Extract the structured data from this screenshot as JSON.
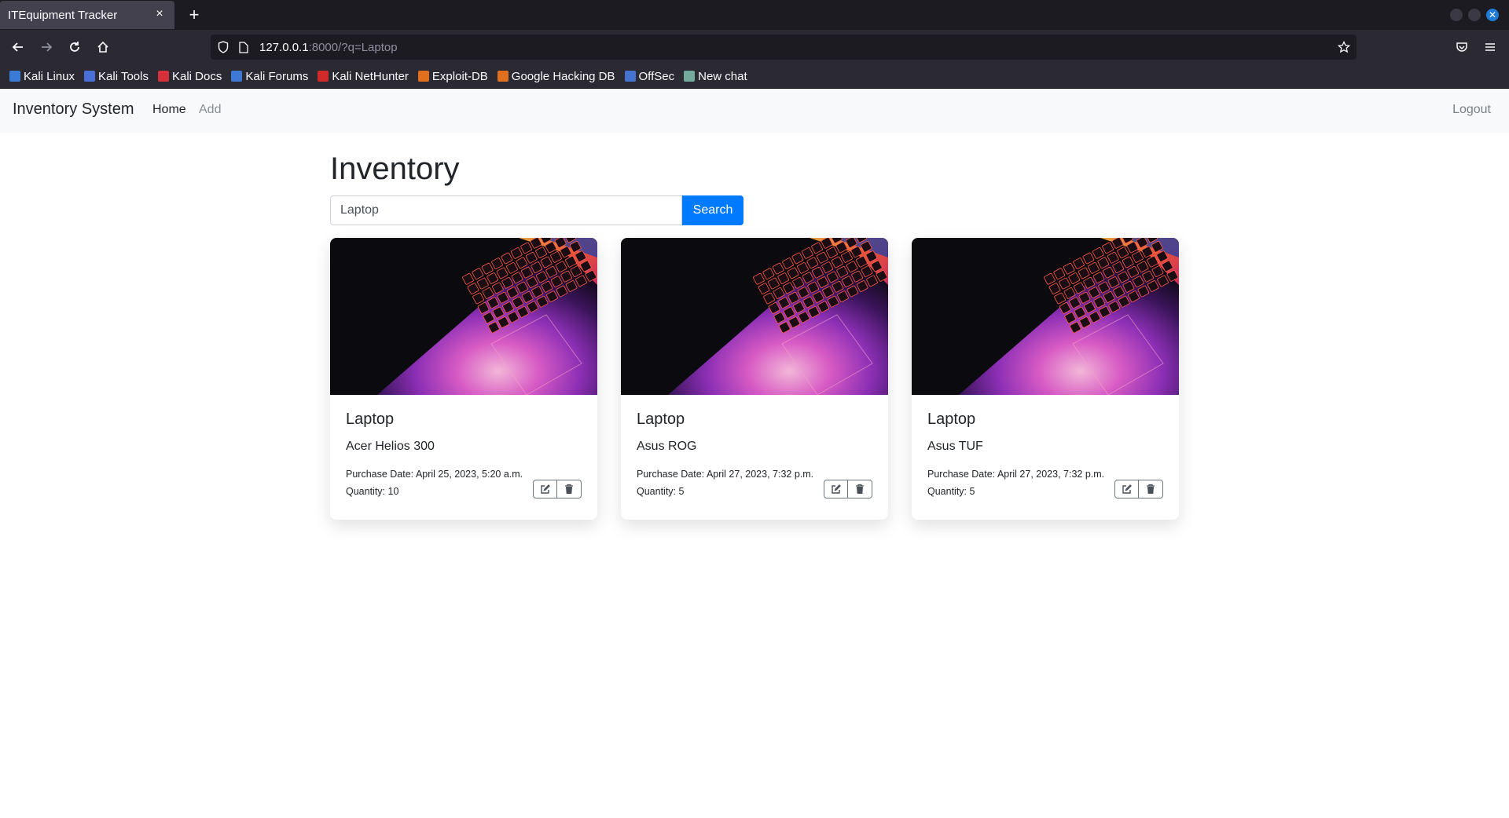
{
  "browser": {
    "tab_title": "ITEquipment Tracker",
    "tab_close": "×",
    "new_tab": "+",
    "url_host": "127.0.0.1",
    "url_rest": ":8000/?q=Laptop",
    "bookmarks": [
      {
        "label": "Kali Linux",
        "color": "#3a7bd5"
      },
      {
        "label": "Kali Tools",
        "color": "#4b6fd8"
      },
      {
        "label": "Kali Docs",
        "color": "#d6303a"
      },
      {
        "label": "Kali Forums",
        "color": "#3e79d6"
      },
      {
        "label": "Kali NetHunter",
        "color": "#d02a2a"
      },
      {
        "label": "Exploit-DB",
        "color": "#e0701e"
      },
      {
        "label": "Google Hacking DB",
        "color": "#e0701e"
      },
      {
        "label": "OffSec",
        "color": "#4473d1"
      },
      {
        "label": "New chat",
        "color": "#74aa9c"
      }
    ]
  },
  "app": {
    "brand": "Inventory System",
    "nav": {
      "home": "Home",
      "add": "Add",
      "logout": "Logout"
    },
    "heading": "Inventory",
    "search": {
      "value": "Laptop",
      "button": "Search"
    },
    "accent": "#007bff",
    "items": [
      {
        "type": "Laptop",
        "model": "Acer Helios 300",
        "purchase_date": "Purchase Date: April 25, 2023, 5:20 a.m.",
        "quantity": "Quantity: 10"
      },
      {
        "type": "Laptop",
        "model": "Asus ROG",
        "purchase_date": "Purchase Date: April 27, 2023, 7:32 p.m.",
        "quantity": "Quantity: 5"
      },
      {
        "type": "Laptop",
        "model": "Asus TUF",
        "purchase_date": "Purchase Date: April 27, 2023, 7:32 p.m.",
        "quantity": "Quantity: 5"
      }
    ]
  }
}
